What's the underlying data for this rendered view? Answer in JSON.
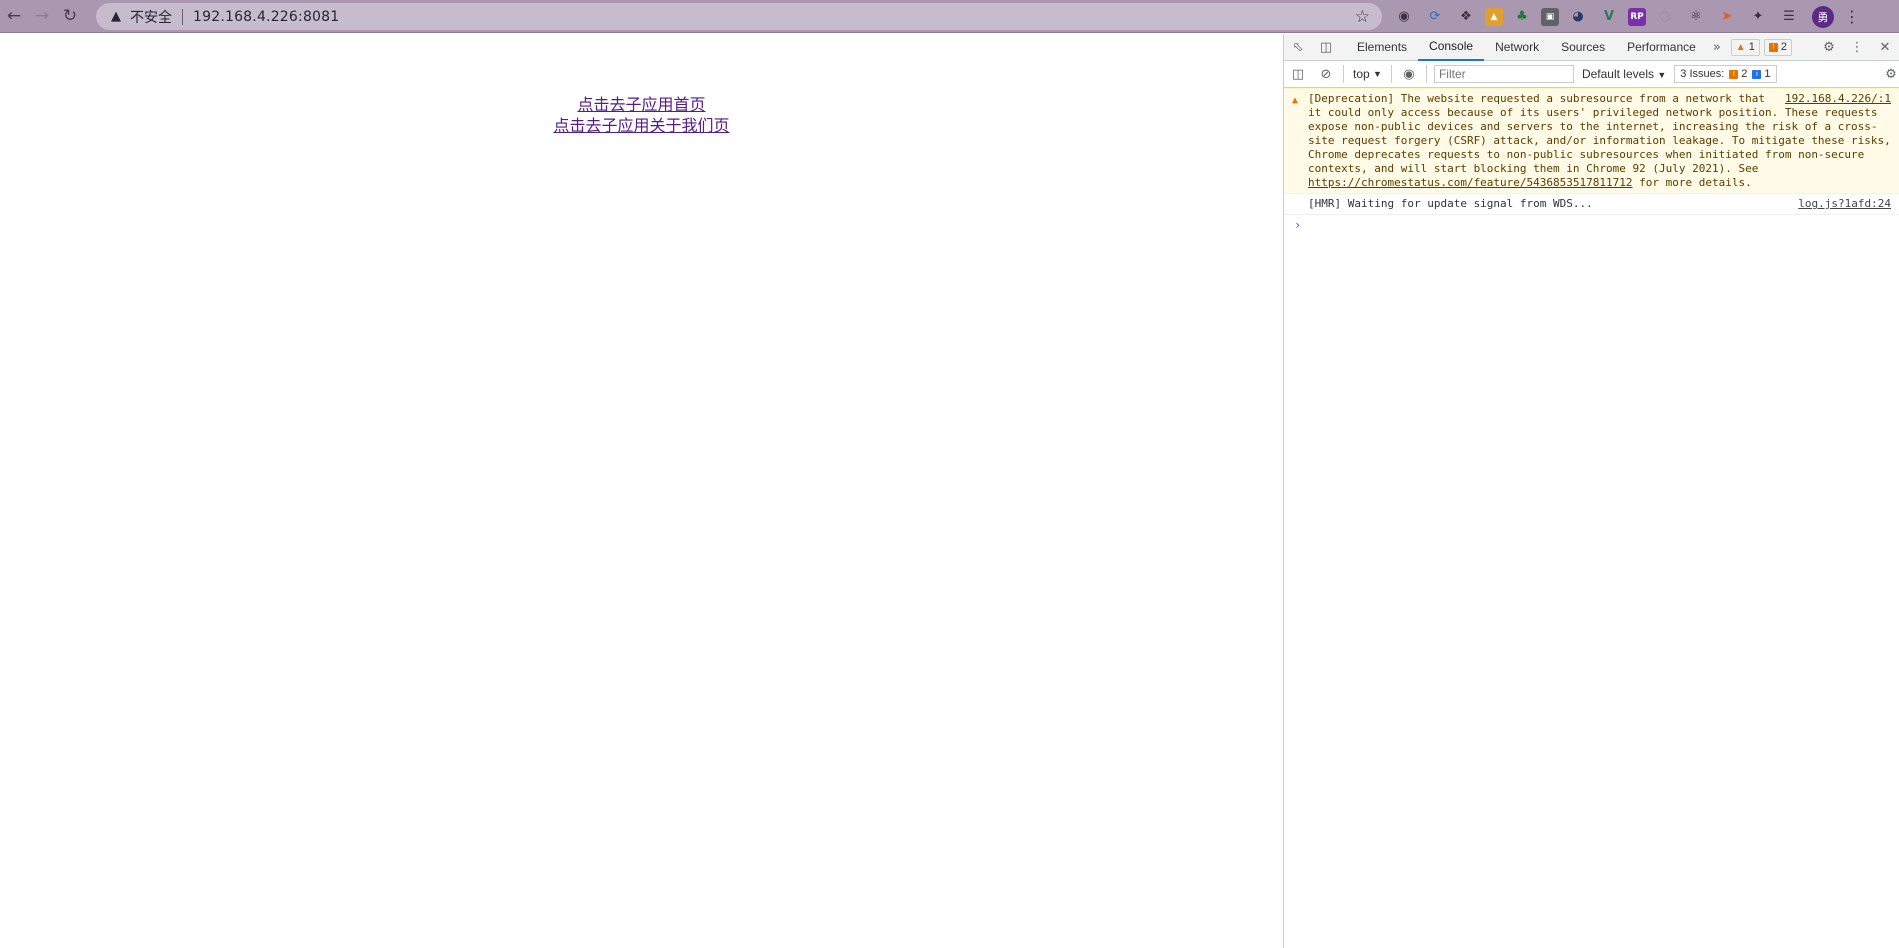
{
  "browser": {
    "security_label": "不安全",
    "url": "192.168.4.226:8081",
    "profile_initial": "勇"
  },
  "page": {
    "links": [
      {
        "label": "点击去子应用首页"
      },
      {
        "label": "点击去子应用关于我们页"
      }
    ]
  },
  "devtools": {
    "tabs": [
      {
        "label": "Elements"
      },
      {
        "label": "Console"
      },
      {
        "label": "Network"
      },
      {
        "label": "Sources"
      },
      {
        "label": "Performance"
      }
    ],
    "active_tab": "Console",
    "warning_count": "1",
    "issue_count_badge": "2",
    "context": "top",
    "filter_placeholder": "Filter",
    "levels_label": "Default levels",
    "issues_label": "3 Issues:",
    "issues_warn": "2",
    "issues_info": "1",
    "messages": [
      {
        "type": "warning",
        "source": "192.168.4.226/:1",
        "text": "[Deprecation] The website requested a subresource from a network that it could only access because of its users' privileged network position. These requests expose non-public devices and servers to the internet, increasing the risk of a cross-site request forgery (CSRF) attack, and/or information leakage. To mitigate these risks, Chrome deprecates requests to non-public subresources when initiated from non-secure contexts, and will start blocking them in Chrome 92 (July 2021). See ",
        "link": "https://chromestatus.com/feature/5436853517811712",
        "tail": " for more details."
      },
      {
        "type": "log",
        "source": "log.js?1afd:24",
        "text": "[HMR] Waiting for update signal from WDS..."
      }
    ]
  }
}
